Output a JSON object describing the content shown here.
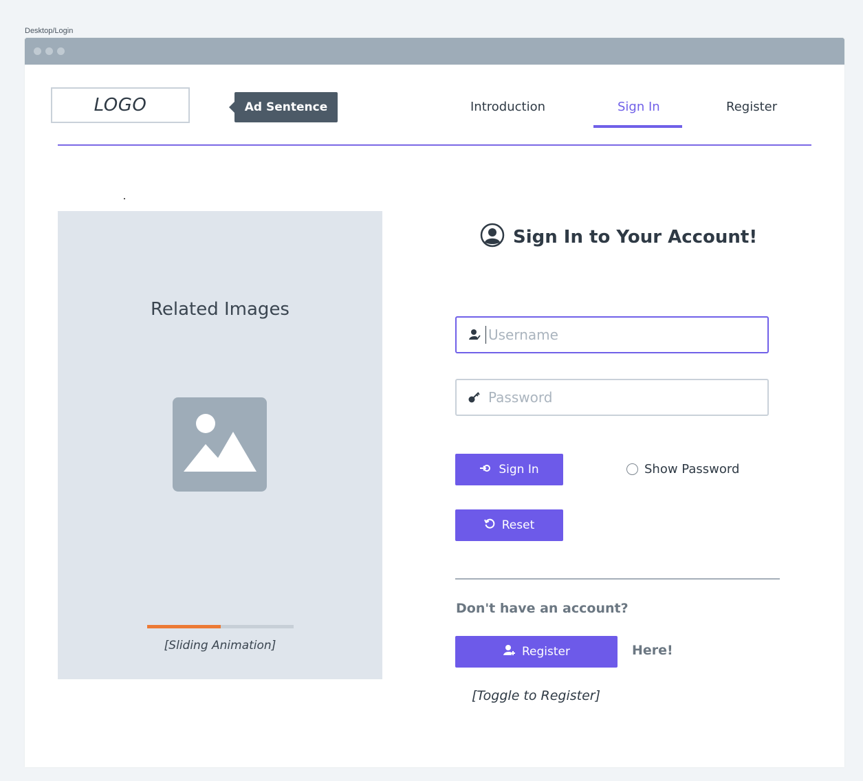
{
  "frame": {
    "label": "Desktop/Login"
  },
  "header": {
    "logo": "LOGO",
    "ad": "Ad Sentence",
    "nav": [
      {
        "label": "Introduction",
        "active": false
      },
      {
        "label": "Sign In",
        "active": true
      },
      {
        "label": "Register",
        "active": false
      }
    ]
  },
  "panel": {
    "title": "Related Images",
    "image_icon": "image-placeholder-icon",
    "progress": 0.5,
    "caption": "[Sliding Animation]"
  },
  "form": {
    "title": "Sign In to Your Account!",
    "title_icon": "user-circle-icon",
    "username": {
      "placeholder": "Username",
      "value": "",
      "icon": "user-check-icon"
    },
    "password": {
      "placeholder": "Password",
      "value": "",
      "icon": "key-icon"
    },
    "sign_in_label": "Sign In",
    "reset_label": "Reset",
    "show_password_label": "Show Password",
    "no_account": "Don't have an account?",
    "register_label": "Register",
    "here": "Here!",
    "toggle_caption": "[Toggle to Register]"
  },
  "colors": {
    "accent": "#6d5ae9",
    "progress": "#ec7a35",
    "panel_bg": "#dfe5ec",
    "titlebar": "#9eacb8",
    "ad_bg": "#4c5a67"
  }
}
